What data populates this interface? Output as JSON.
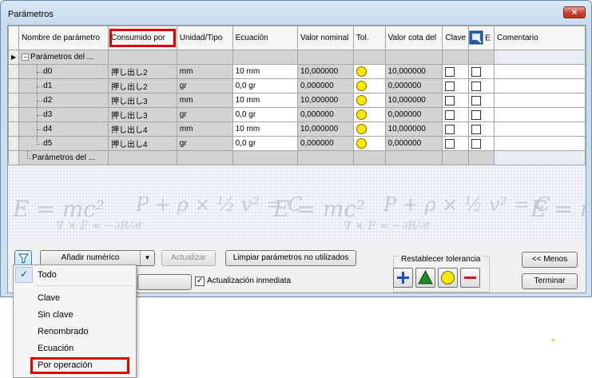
{
  "window": {
    "title": "Parámetros",
    "close_label": "×"
  },
  "grid": {
    "headers": [
      "Nombre de parámetro",
      "Consumido por",
      "Unidad/Tipo",
      "Ecuación",
      "Valor nominal",
      "Tol.",
      "Valor cota del",
      "Clave",
      "",
      "Comentario"
    ],
    "header_icon_suffix": "E",
    "group_label": "Parámetros del ...",
    "rows": [
      {
        "name": "d0",
        "consumed": "押し出し2",
        "unit": "mm",
        "equation": "10 mm",
        "nominal": "10,000000",
        "model": "10,000000"
      },
      {
        "name": "d1",
        "consumed": "押し出し2",
        "unit": "gr",
        "equation": "0,0 gr",
        "nominal": "0,000000",
        "model": "0,000000"
      },
      {
        "name": "d2",
        "consumed": "押し出し3",
        "unit": "mm",
        "equation": "10 mm",
        "nominal": "10,000000",
        "model": "10,000000"
      },
      {
        "name": "d3",
        "consumed": "押し出し3",
        "unit": "gr",
        "equation": "0,0 gr",
        "nominal": "0,000000",
        "model": "0,000000"
      },
      {
        "name": "d4",
        "consumed": "押し出し4",
        "unit": "mm",
        "equation": "10 mm",
        "nominal": "10,000000",
        "model": "10,000000"
      },
      {
        "name": "d5",
        "consumed": "押し出し4",
        "unit": "gr",
        "equation": "0,0 gr",
        "nominal": "0,000000",
        "model": "0,000000"
      }
    ],
    "user_group_label": "Parámetros del ...",
    "highlight_color": "#e00000",
    "tolerance_color": "#ffe800"
  },
  "toolbar": {
    "add_numeric_label": "Añadir numérico",
    "update_label": "Actualizar",
    "purge_label": "Limpiar parámetros no utilizados",
    "immediate_update_label": "Actualización inmediata",
    "immediate_update_checked": true,
    "reset_tolerance_label": "Restablecer tolerancia",
    "less_label": "<< Menos",
    "done_label": "Terminar"
  },
  "filter_menu": {
    "items": [
      "Todo",
      "Clave",
      "Sin clave",
      "Renombrado",
      "Ecuación",
      "Por operación"
    ],
    "checked_index": 0,
    "check_glyph": "✓"
  },
  "icons": {
    "filter": "filter-icon",
    "plus": "plus-icon",
    "triangle": "triangle-icon",
    "circle": "circle-icon",
    "minus": "minus-icon",
    "export": "export-icon"
  }
}
